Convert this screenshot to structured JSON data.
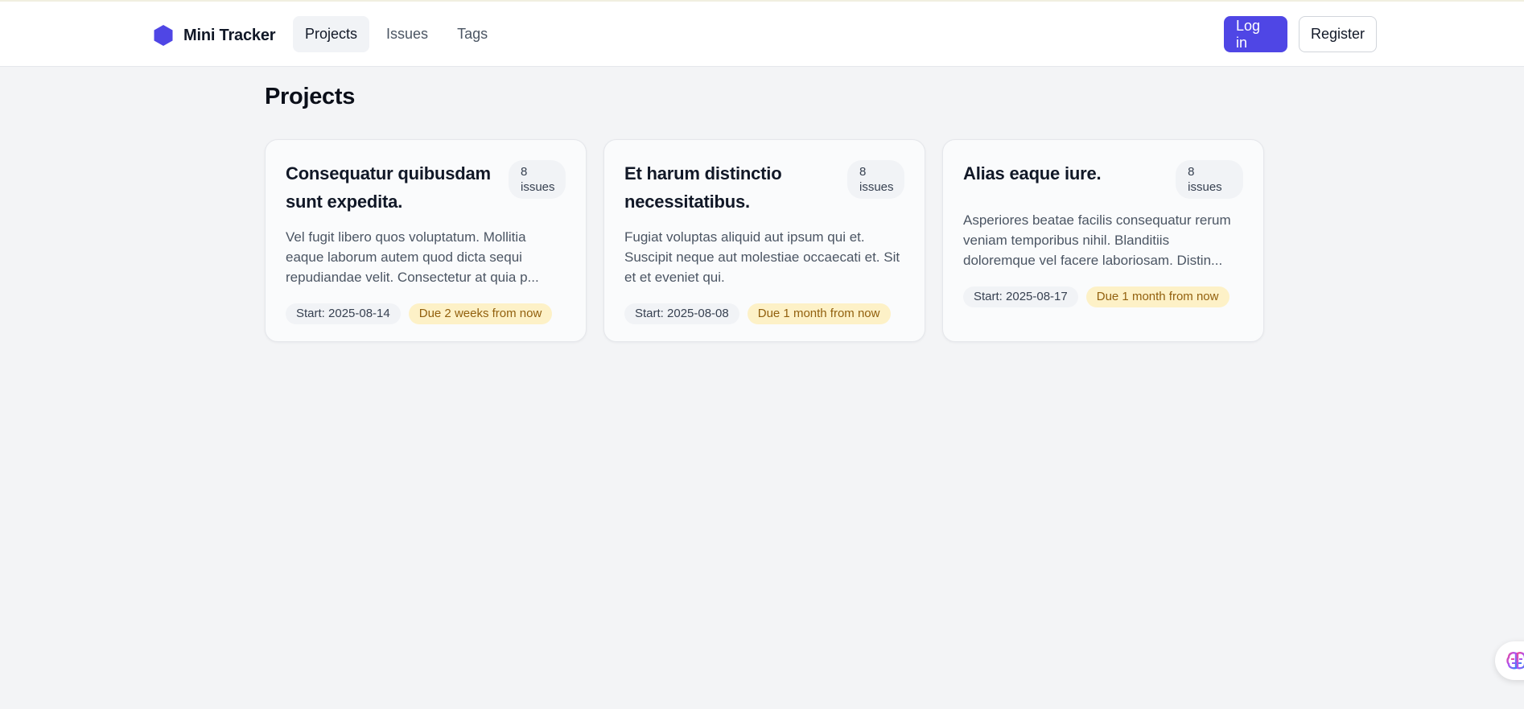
{
  "app": {
    "name": "Mini Tracker"
  },
  "nav": {
    "links": [
      {
        "label": "Projects",
        "active": true
      },
      {
        "label": "Issues",
        "active": false
      },
      {
        "label": "Tags",
        "active": false
      }
    ],
    "login_label": "Log in",
    "register_label": "Register"
  },
  "page": {
    "title": "Projects"
  },
  "projects": [
    {
      "title": "Consequatur quibusdam sunt expedita.",
      "issues": "8 issues",
      "description": "Vel fugit libero quos voluptatum. Mollitia eaque laborum autem quod dicta sequi repudiandae velit. Consectetur at quia p...",
      "start": "Start: 2025-08-14",
      "due": "Due 2 weeks from now"
    },
    {
      "title": "Et harum distinctio necessitatibus.",
      "issues": "8 issues",
      "description": "Fugiat voluptas aliquid aut ipsum qui et. Suscipit neque aut molestiae occaecati et. Sit et et eveniet qui.",
      "start": "Start: 2025-08-08",
      "due": "Due 1 month from now"
    },
    {
      "title": "Alias eaque iure.",
      "issues": "8 issues",
      "description": "Asperiores beatae facilis consequatur rerum veniam temporibus nihil. Blanditiis doloremque vel facere laboriosam. Distin...",
      "start": "Start: 2025-08-17",
      "due": "Due 1 month from now"
    }
  ],
  "colors": {
    "accent": "#4f46e5",
    "background": "#f3f4f6",
    "due_badge_bg": "#fdf1c7",
    "due_badge_text": "#92600e"
  },
  "icons": {
    "brand": "hexagon-icon",
    "floating_widget": "brain-icon"
  }
}
